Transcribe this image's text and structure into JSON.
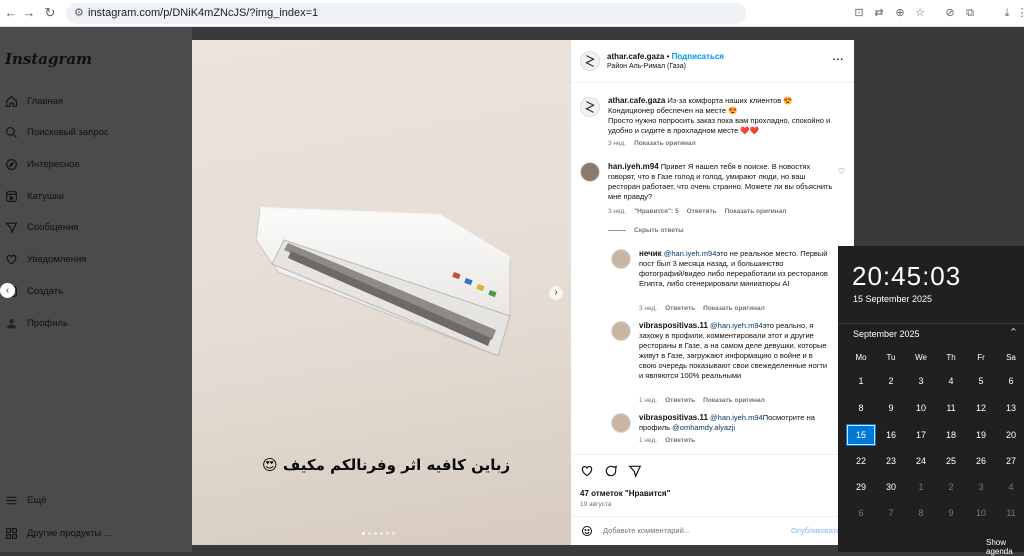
{
  "browser": {
    "url": "instagram.com/p/DNiK4mZNcJS/?img_index=1"
  },
  "sidebar": {
    "logo": "Instagram",
    "items": [
      {
        "label": "Главная",
        "icon": "home-icon"
      },
      {
        "label": "Поисковый запрос",
        "icon": "search-icon"
      },
      {
        "label": "Интересное",
        "icon": "compass-icon"
      },
      {
        "label": "Катушки",
        "icon": "reels-icon"
      },
      {
        "label": "Сообщения",
        "icon": "send-icon"
      },
      {
        "label": "Уведомления",
        "icon": "heart-icon"
      },
      {
        "label": "Создать",
        "icon": "plus-icon"
      },
      {
        "label": "Профиль",
        "icon": "profile-icon"
      }
    ],
    "more": "Ещё",
    "other": "Другие продукты ..."
  },
  "media": {
    "caption_ar": "زباين كافيه اثر وفرنالكم مكيف 😍"
  },
  "post": {
    "author": "athar.cafe.gaza",
    "follow": "Подписаться",
    "location": "Район Аль-Римал (Газа)",
    "more": "...",
    "caption_user": "athar.cafe.gaza",
    "caption_line1": "Из-за комфорта наших клиентов 😍",
    "caption_line2": "Кондиционер обеспечен на месте 😍",
    "caption_line3": "Просто нужно попросить заказ пока вам прохладно, спокойно и",
    "caption_line4": "удобно и сидите в прохладном месте ❤️❤️",
    "caption_time": "3 нед.",
    "caption_show_orig": "Показать оригинал"
  },
  "comments": [
    {
      "user": "han.iyeh.m94",
      "text": "Привет Я нашел тебя в поиске. В новостях говорят, что в Газе голод и голод, умирают люди, но ваш ресторан работает, что очень странно. Можете ли вы объяснить мне правду?",
      "time": "3 нед.",
      "likes": "\"Нравится\": 5",
      "reply": "Ответить",
      "show_orig": "Показать оригинал"
    }
  ],
  "hide_replies": "Скрыть ответы",
  "replies": [
    {
      "user": "нечик",
      "mention": "@han.iyeh.m94",
      "text": "это не реальное место. Первый пост был 3 месяца назад, и большинство фотографий/видео либо переработали из ресторанов Египта, либо сгенерировали миниатюры AI",
      "time": "3 нед.",
      "reply": "Ответить",
      "show_orig": "Показать оригинал"
    },
    {
      "user": "vibraspositivas.11",
      "mention": "@han.iyeh.m94",
      "text": "это реально, я захожу в профили, комментировали этот и другие рестораны в Газе, а на самом деле девушки, которые живут в Газе, загружают информацию о войне и в свою очередь показывают свои свежеделенные ногти и являются 100% реальными",
      "time": "1 нед.",
      "reply": "Ответить",
      "show_orig": "Показать оригинал"
    },
    {
      "user": "vibraspositivas.11",
      "mention": "@han.iyeh.m94",
      "text": "Посмотрите на профиль",
      "mention2": "@omhamdy.alyazji",
      "time": "1 нед.",
      "reply": "Ответить"
    }
  ],
  "actions": {
    "likes": "47 отметок \"Нравится\"",
    "date": "19 августа",
    "comment_placeholder": "Добавьте комментарий...",
    "publish": "Опубликовать"
  },
  "clock": {
    "time": "20:45:03",
    "date": "15 September 2025",
    "month": "September 2025",
    "dow": [
      "Mo",
      "Tu",
      "We",
      "Th",
      "Fr",
      "Sa"
    ],
    "weeks": [
      [
        "1",
        "2",
        "3",
        "4",
        "5",
        "6"
      ],
      [
        "8",
        "9",
        "10",
        "11",
        "12",
        "13"
      ],
      [
        "15",
        "16",
        "17",
        "18",
        "19",
        "20"
      ],
      [
        "22",
        "23",
        "24",
        "25",
        "26",
        "27"
      ],
      [
        "29",
        "30",
        "1",
        "2",
        "3",
        "4"
      ],
      [
        "6",
        "7",
        "8",
        "9",
        "10",
        "11"
      ]
    ],
    "today": "15",
    "show_agenda": "Show agenda"
  }
}
